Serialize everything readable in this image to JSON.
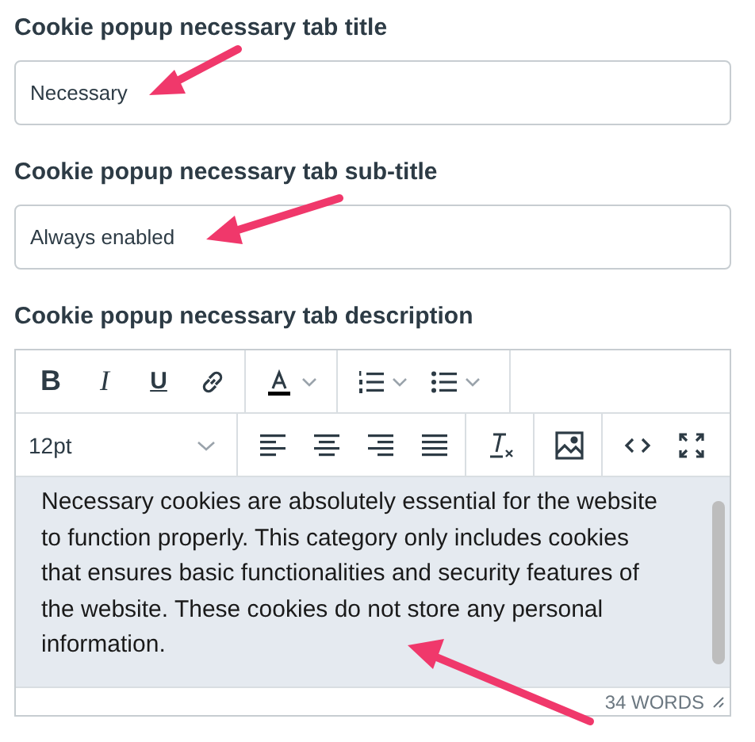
{
  "fields": [
    {
      "kind": "input",
      "label": "Cookie popup necessary tab title",
      "value": "Necessary"
    },
    {
      "kind": "input",
      "label": "Cookie popup necessary tab sub-title",
      "value": "Always enabled"
    },
    {
      "kind": "editor",
      "label": "Cookie popup necessary tab description",
      "format_buttons": [
        "B",
        "I",
        "U"
      ],
      "font_size": "12pt",
      "content": "Necessary cookies are absolutely essential for the website to function properly. This category only includes cookies that ensures basic functionalities and security features of the website. These cookies do not store any personal information.",
      "word_count": "34 WORDS"
    }
  ]
}
